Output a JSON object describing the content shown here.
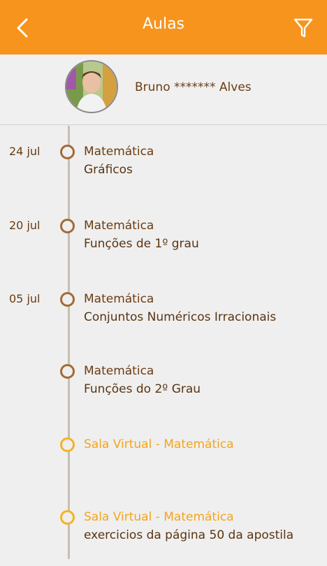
{
  "header": {
    "title": "Aulas"
  },
  "profile": {
    "name": "Bruno  *******  Alves"
  },
  "entries": [
    {
      "date": "24 jul",
      "subject": "Matemática",
      "topic": "Gráficos"
    },
    {
      "date": "20 jul",
      "subject": "Matemática",
      "topic": "Funções de 1º grau"
    },
    {
      "date": "05 jul",
      "subject": "Matemática",
      "topic": "Conjuntos Numéricos Irracionais"
    },
    {
      "date": "",
      "subject": "Matemática",
      "topic": "Funções do 2º Grau"
    },
    {
      "date": "",
      "subject": "Sala Virtual - Matemática",
      "topic": ""
    },
    {
      "date": "",
      "subject": "Sala Virtual - Matemática",
      "topic": "exercicios da página 50 da apostila"
    }
  ],
  "colors": {
    "header": "#f7941e",
    "text_brown": "#6b3c12",
    "dot_brown": "#a36a36",
    "highlight_yellow": "#f4a41e"
  },
  "icons": [
    "back-arrow-icon",
    "filter-icon"
  ]
}
